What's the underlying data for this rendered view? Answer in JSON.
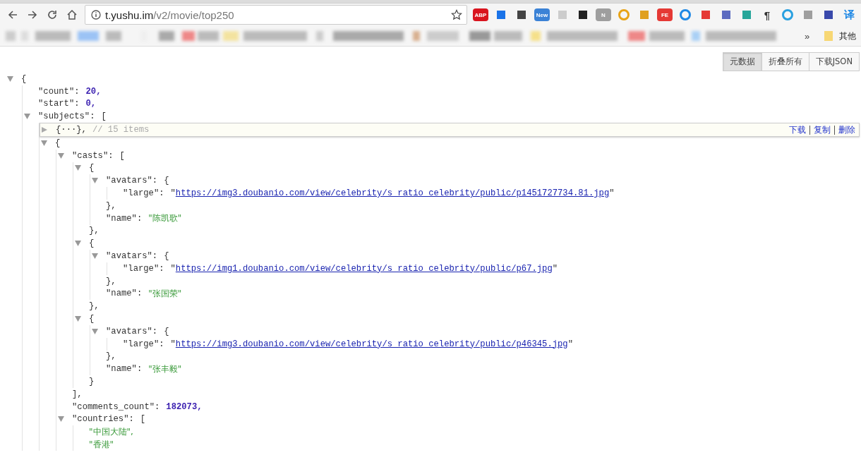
{
  "browser": {
    "address": {
      "host": "t.yushu.im",
      "path": "/v2/movie/top250"
    },
    "extensions": [
      {
        "kind": "badge",
        "label": "ABP",
        "color": "#d9141e"
      },
      {
        "kind": "shape",
        "color": "#1a73e8"
      },
      {
        "kind": "shape",
        "color": "#444444"
      },
      {
        "kind": "badge",
        "label": "New",
        "color": "#3b82d6"
      },
      {
        "kind": "shape",
        "color": "#cccccc"
      },
      {
        "kind": "shape",
        "color": "#222222"
      },
      {
        "kind": "badge",
        "label": "N",
        "color": "#9e9e9e"
      },
      {
        "kind": "ring",
        "color": "#e8a317"
      },
      {
        "kind": "shape",
        "color": "#e0a020"
      },
      {
        "kind": "badge",
        "label": "FE",
        "color": "#e53935"
      },
      {
        "kind": "ring",
        "color": "#1e88e5"
      },
      {
        "kind": "shape",
        "color": "#e53935"
      },
      {
        "kind": "shape",
        "color": "#5c6bc0"
      },
      {
        "kind": "shape",
        "color": "#26a69a"
      },
      {
        "kind": "glyph",
        "label": "¶",
        "color": "#333333"
      },
      {
        "kind": "ring",
        "color": "#29a0e0"
      },
      {
        "kind": "shape",
        "color": "#9e9e9e"
      },
      {
        "kind": "shape",
        "color": "#3949ab"
      },
      {
        "kind": "glyph",
        "label": "译",
        "color": "#1e88e5"
      }
    ],
    "bookmarks": {
      "more": "»",
      "folder": "其他"
    }
  },
  "viewer": {
    "buttons": [
      {
        "label": "元数据",
        "selected": true
      },
      {
        "label": "折叠所有",
        "selected": false
      },
      {
        "label": "下载JSON",
        "selected": false
      }
    ],
    "root": {
      "kind": "container",
      "expanded": true,
      "open": "{",
      "children": [
        {
          "kind": "number",
          "key": "\"count\":",
          "value": "20,"
        },
        {
          "kind": "number",
          "key": "\"start\":",
          "value": "0,"
        },
        {
          "kind": "container",
          "key": "\"subjects\":",
          "open": "[",
          "expanded": true,
          "children": [
            {
              "kind": "collapsed",
              "expanded": false,
              "open": "{···},",
              "comment": "// 15 items",
              "actions": [
                "下载",
                "复制",
                "删除"
              ]
            },
            {
              "kind": "container",
              "open": "{",
              "expanded": true,
              "children": [
                {
                  "kind": "container",
                  "key": "\"casts\":",
                  "open": "[",
                  "expanded": true,
                  "close": "],",
                  "children": [
                    {
                      "kind": "container",
                      "open": "{",
                      "expanded": true,
                      "close": "},",
                      "children": [
                        {
                          "kind": "container",
                          "key": "\"avatars\":",
                          "open": "{",
                          "expanded": true,
                          "close": "},",
                          "children": [
                            {
                              "kind": "link",
                              "key": "\"large\":",
                              "before": "\"",
                              "value": "https://img3.doubanio.com/view/celebrity/s_ratio_celebrity/public/p1451727734.81.jpg",
                              "after": "\""
                            }
                          ]
                        },
                        {
                          "kind": "string",
                          "key": "\"name\":",
                          "value": "\"陈凯歌\""
                        }
                      ]
                    },
                    {
                      "kind": "container",
                      "open": "{",
                      "expanded": true,
                      "close": "},",
                      "children": [
                        {
                          "kind": "container",
                          "key": "\"avatars\":",
                          "open": "{",
                          "expanded": true,
                          "close": "},",
                          "children": [
                            {
                              "kind": "link",
                              "key": "\"large\":",
                              "before": "\"",
                              "value": "https://img1.doubanio.com/view/celebrity/s_ratio_celebrity/public/p67.jpg",
                              "after": "\""
                            }
                          ]
                        },
                        {
                          "kind": "string",
                          "key": "\"name\":",
                          "value": "\"张国荣\""
                        }
                      ]
                    },
                    {
                      "kind": "container",
                      "open": "{",
                      "expanded": true,
                      "close": "}",
                      "children": [
                        {
                          "kind": "container",
                          "key": "\"avatars\":",
                          "open": "{",
                          "expanded": true,
                          "close": "},",
                          "children": [
                            {
                              "kind": "link",
                              "key": "\"large\":",
                              "before": "\"",
                              "value": "https://img3.doubanio.com/view/celebrity/s_ratio_celebrity/public/p46345.jpg",
                              "after": "\""
                            }
                          ]
                        },
                        {
                          "kind": "string",
                          "key": "\"name\":",
                          "value": "\"张丰毅\""
                        }
                      ]
                    }
                  ]
                },
                {
                  "kind": "number",
                  "key": "\"comments_count\":",
                  "value": "182073,"
                },
                {
                  "kind": "container",
                  "key": "\"countries\":",
                  "open": "[",
                  "expanded": true,
                  "children": [
                    {
                      "kind": "string",
                      "value": "\"中国大陆\","
                    },
                    {
                      "kind": "string",
                      "value": "\"香港\""
                    }
                  ]
                }
              ]
            }
          ]
        }
      ]
    }
  }
}
